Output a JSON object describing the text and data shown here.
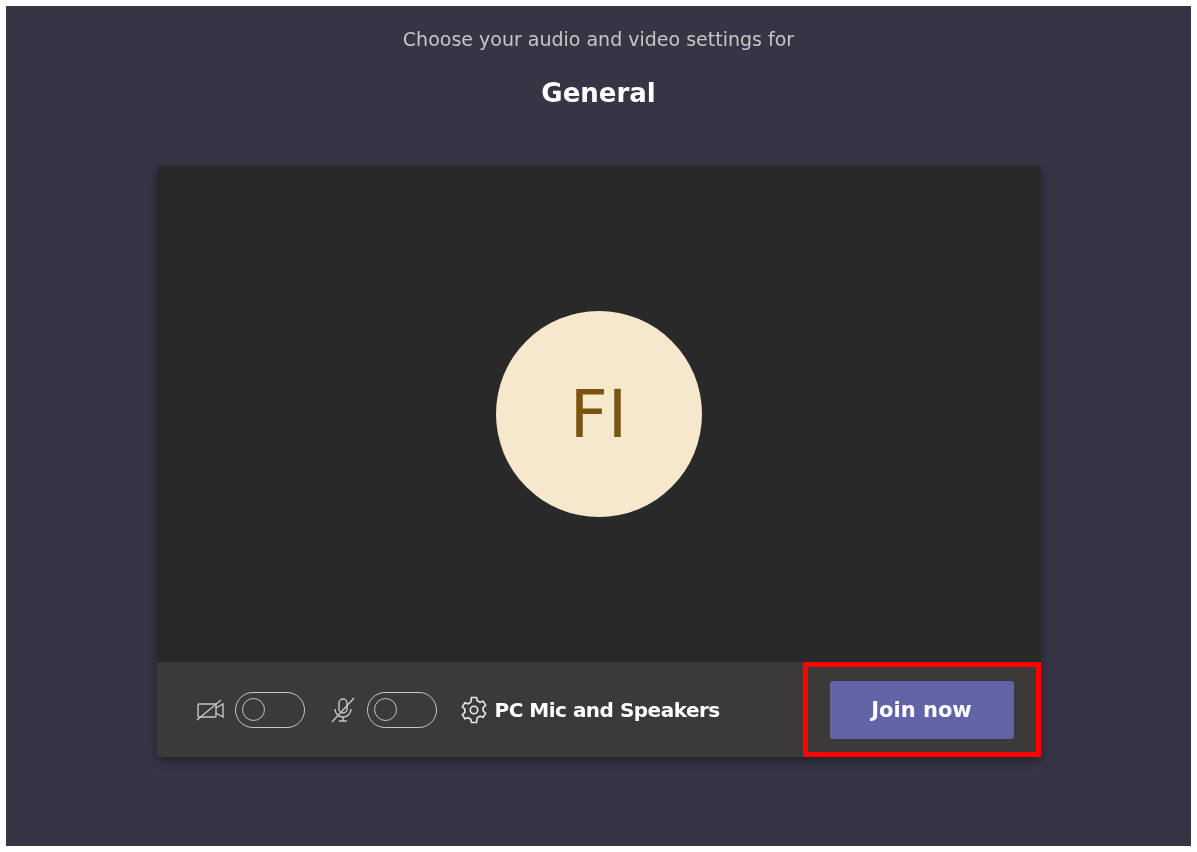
{
  "subtitle": "Choose your audio and video settings for",
  "title": "General",
  "avatar": {
    "initials": "FI"
  },
  "controls": [
    {
      "kind": "camera",
      "on": false
    },
    {
      "kind": "mic",
      "on": false
    }
  ],
  "device": {
    "label": "PC Mic and Speakers"
  },
  "join_button": {
    "label": "Join now",
    "highlighted": true
  }
}
